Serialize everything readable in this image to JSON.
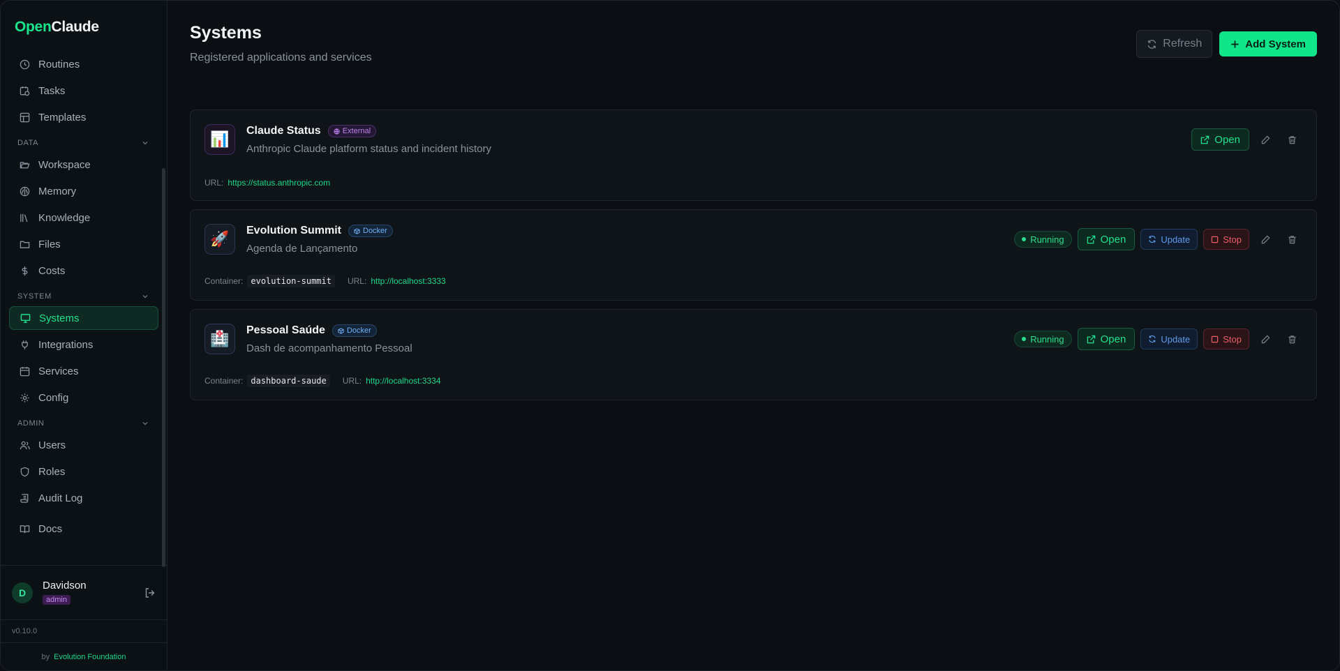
{
  "brand": {
    "part1": "Open",
    "part2": "Claude"
  },
  "sidebar": {
    "top_items": [
      {
        "label": "Routines",
        "icon": "clock-icon"
      },
      {
        "label": "Tasks",
        "icon": "calendar-clock-icon"
      },
      {
        "label": "Templates",
        "icon": "layout-icon"
      }
    ],
    "sections": [
      {
        "label": "DATA",
        "items": [
          {
            "label": "Workspace",
            "icon": "folder-open-icon"
          },
          {
            "label": "Memory",
            "icon": "brain-icon"
          },
          {
            "label": "Knowledge",
            "icon": "library-icon"
          },
          {
            "label": "Files",
            "icon": "folder-icon"
          },
          {
            "label": "Costs",
            "icon": "dollar-icon"
          }
        ]
      },
      {
        "label": "SYSTEM",
        "items": [
          {
            "label": "Systems",
            "icon": "monitor-icon",
            "active": true
          },
          {
            "label": "Integrations",
            "icon": "plug-icon"
          },
          {
            "label": "Services",
            "icon": "calendar-icon"
          },
          {
            "label": "Config",
            "icon": "gear-icon"
          }
        ]
      },
      {
        "label": "ADMIN",
        "items": [
          {
            "label": "Users",
            "icon": "users-icon"
          },
          {
            "label": "Roles",
            "icon": "shield-icon"
          },
          {
            "label": "Audit Log",
            "icon": "scroll-icon"
          }
        ]
      }
    ],
    "docs": "Docs",
    "user": {
      "initial": "D",
      "name": "Davidson",
      "role": "admin"
    },
    "version": "v0.10.0",
    "by": "by",
    "foundation": "Evolution Foundation"
  },
  "header": {
    "title": "Systems",
    "subtitle": "Registered applications and services",
    "refresh": "Refresh",
    "add": "Add System"
  },
  "systems": [
    {
      "name": "Claude Status",
      "badge": "External",
      "desc": "Anthropic Claude platform status and incident history",
      "icon": "📊",
      "url_label": "URL:",
      "url": "https://status.anthropic.com",
      "open": "Open"
    },
    {
      "name": "Evolution Summit",
      "badge": "Docker",
      "desc": "Agenda de Lançamento",
      "icon": "🚀",
      "status": "Running",
      "container_label": "Container:",
      "container": "evolution-summit",
      "url_label": "URL:",
      "url": "http://localhost:3333",
      "open": "Open",
      "update": "Update",
      "stop": "Stop"
    },
    {
      "name": "Pessoal Saúde",
      "badge": "Docker",
      "desc": "Dash de acompanhamento Pessoal",
      "icon": "🏥",
      "status": "Running",
      "container_label": "Container:",
      "container": "dashboard-saude",
      "url_label": "URL:",
      "url": "http://localhost:3334",
      "open": "Open",
      "update": "Update",
      "stop": "Stop"
    }
  ]
}
